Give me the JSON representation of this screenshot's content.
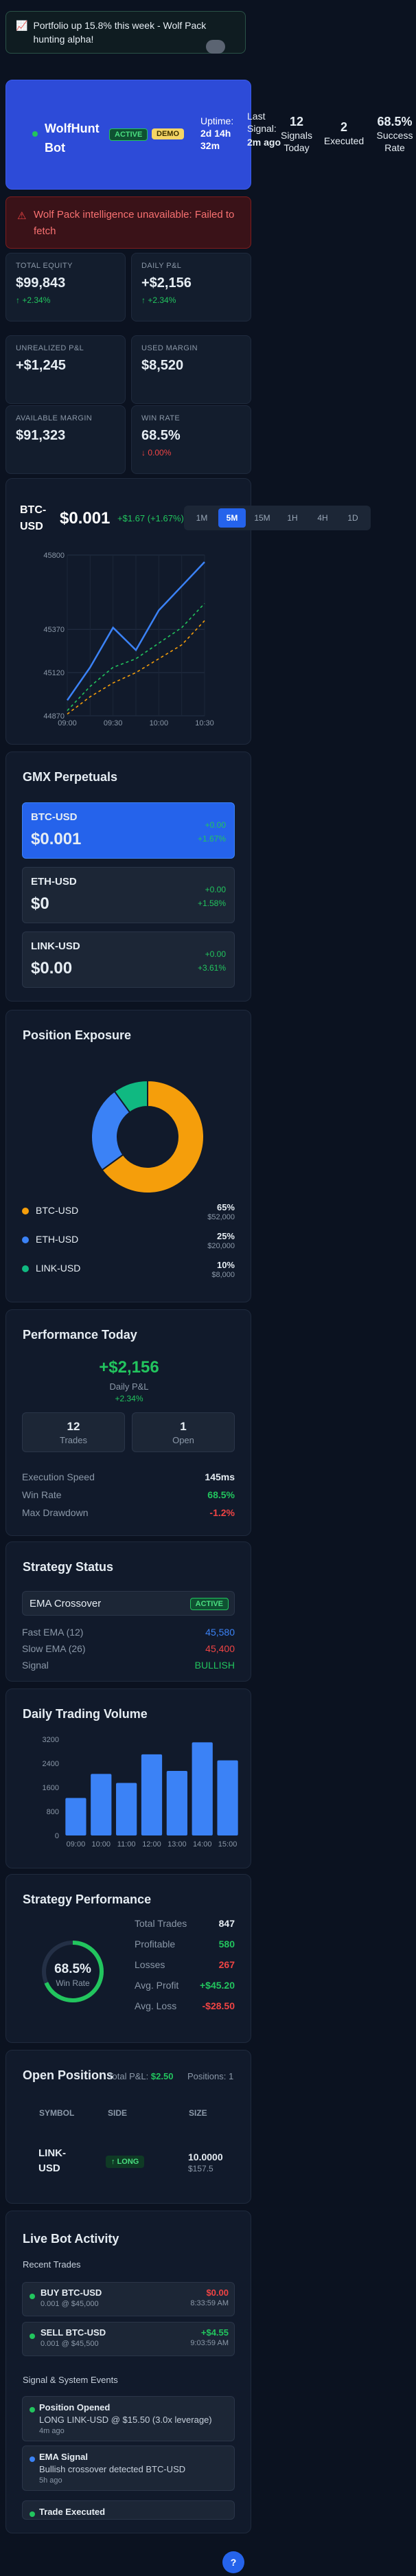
{
  "toast": {
    "text": "Portfolio up 15.8% this week - Wolf Pack hunting alpha!",
    "icon": "chart-up-icon"
  },
  "hero": {
    "bot_name": "WolfHunt Bot",
    "badge_active": "ACTIVE",
    "badge_demo": "DEMO",
    "uptime_label": "Uptime:",
    "uptime_value": "2d 14h 32m",
    "last_signal_label": "Last Signal:",
    "last_signal_value": "2m ago",
    "signals_today_value": "12",
    "signals_today_label": "Signals Today",
    "executed_value": "2",
    "executed_label": "Executed",
    "success_value": "68.5%",
    "success_label": "Success Rate"
  },
  "alert": {
    "text": "Wolf Pack intelligence unavailable: Failed to fetch",
    "icon": "warning-icon"
  },
  "metrics": [
    {
      "label": "TOTAL EQUITY",
      "value": "$99,843",
      "sub": "+2.34%",
      "sub_color": "#22c55e",
      "arrow": "↑"
    },
    {
      "label": "DAILY P&L",
      "value": "+$2,156",
      "sub": "+2.34%",
      "sub_color": "#22c55e",
      "arrow": "↑"
    },
    {
      "label": "UNREALIZED P&L",
      "value": "+$1,245",
      "sub": "",
      "sub_color": "#22c55e",
      "arrow": ""
    },
    {
      "label": "USED MARGIN",
      "value": "$8,520",
      "sub": "",
      "sub_color": "#22c55e",
      "arrow": ""
    },
    {
      "label": "AVAILABLE MARGIN",
      "value": "$91,323",
      "sub": "",
      "sub_color": "#22c55e",
      "arrow": ""
    },
    {
      "label": "WIN RATE",
      "value": "68.5%",
      "sub": "0.00%",
      "sub_color": "#ef4444",
      "arrow": "↓"
    }
  ],
  "price_chart": {
    "symbol": "BTC-USD",
    "price": "$0.001",
    "change": "+$1.67 (+1.67%)",
    "timeframes": [
      "1M",
      "5M",
      "15M",
      "1H",
      "4H",
      "1D"
    ],
    "active_timeframe": "5M"
  },
  "chart_data": {
    "type": "line",
    "x": [
      "09:00",
      "09:15",
      "09:30",
      "09:45",
      "10:00",
      "10:15",
      "10:30"
    ],
    "x_ticks": [
      "09:00",
      "09:30",
      "10:00",
      "10:30"
    ],
    "y_ticks": [
      "44870",
      "45120",
      "45370",
      "45800"
    ],
    "ylim": [
      44870,
      45800
    ],
    "series": [
      {
        "color": "#3b82f6",
        "style": "solid",
        "values": [
          44960,
          45150,
          45380,
          45250,
          45480,
          45620,
          45760
        ]
      },
      {
        "color": "#22c55e",
        "style": "dashed",
        "values": [
          44900,
          45040,
          45150,
          45200,
          45290,
          45380,
          45520
        ]
      },
      {
        "color": "#f59e0b",
        "style": "dashed",
        "values": [
          44880,
          44980,
          45060,
          45120,
          45200,
          45280,
          45420
        ]
      }
    ],
    "grid": true
  },
  "perpetuals": {
    "title": "GMX Perpetuals",
    "items": [
      {
        "symbol": "BTC-USD",
        "price": "$0.001",
        "change_abs": "+0.00",
        "change_pct": "+1.67%",
        "active": true
      },
      {
        "symbol": "ETH-USD",
        "price": "$0",
        "change_abs": "+0.00",
        "change_pct": "+1.58%",
        "active": false
      },
      {
        "symbol": "LINK-USD",
        "price": "$0.00",
        "change_abs": "+0.00",
        "change_pct": "+3.61%",
        "active": false
      }
    ]
  },
  "exposure": {
    "title": "Position Exposure",
    "slices": [
      {
        "name": "BTC-USD",
        "pct": "65%",
        "value": "$52,000",
        "fraction": 0.65,
        "color": "#f59e0b"
      },
      {
        "name": "ETH-USD",
        "pct": "25%",
        "value": "$20,000",
        "fraction": 0.25,
        "color": "#3b82f6"
      },
      {
        "name": "LINK-USD",
        "pct": "10%",
        "value": "$8,000",
        "fraction": 0.1,
        "color": "#10b981"
      }
    ]
  },
  "performance_today": {
    "title": "Performance Today",
    "pnl": "+$2,156",
    "pnl_label": "Daily P&L",
    "pnl_pct": "+2.34%",
    "trades_value": "12",
    "trades_label": "Trades",
    "open_value": "1",
    "open_label": "Open",
    "rows": [
      {
        "label": "Execution Speed",
        "value": "145ms",
        "color": "#e6edf3"
      },
      {
        "label": "Win Rate",
        "value": "68.5%",
        "color": "#22c55e"
      },
      {
        "label": "Max Drawdown",
        "value": "-1.2%",
        "color": "#ef4444"
      }
    ]
  },
  "strategy_status": {
    "title": "Strategy Status",
    "strategy": "EMA Crossover",
    "badge": "ACTIVE",
    "rows": [
      {
        "label": "Fast EMA (12)",
        "value": "45,580",
        "color": "#3b82f6"
      },
      {
        "label": "Slow EMA (26)",
        "value": "45,400",
        "color": "#ef4444"
      },
      {
        "label": "Signal",
        "value": "BULLISH",
        "color": "#22c55e"
      }
    ]
  },
  "volume": {
    "title": "Daily Trading Volume",
    "y_ticks": [
      "0",
      "800",
      "1600",
      "2400",
      "3200"
    ],
    "categories": [
      "09:00",
      "10:00",
      "11:00",
      "12:00",
      "13:00",
      "14:00",
      "15:00"
    ],
    "values": [
      1250,
      2050,
      1750,
      2700,
      2150,
      3100,
      2500
    ],
    "ymax": 3200
  },
  "strategy_perf": {
    "title": "Strategy Performance",
    "win_rate": "68.5%",
    "win_rate_label": "Win Rate",
    "win_fraction": 0.685,
    "rows": [
      {
        "label": "Total Trades",
        "value": "847",
        "color": "#e6edf3"
      },
      {
        "label": "Profitable",
        "value": "580",
        "color": "#22c55e"
      },
      {
        "label": "Losses",
        "value": "267",
        "color": "#ef4444"
      },
      {
        "label": "Avg. Profit",
        "value": "+$45.20",
        "color": "#22c55e"
      },
      {
        "label": "Avg. Loss",
        "value": "-$28.50",
        "color": "#ef4444"
      }
    ]
  },
  "positions": {
    "title": "Open Positions",
    "total_pnl_label": "Total P&L:",
    "total_pnl_value": "$2.50",
    "count_label": "Positions: 1",
    "columns": [
      "SYMBOL",
      "SIDE",
      "SIZE"
    ],
    "rows": [
      {
        "symbol": "LINK-USD",
        "side": "LONG",
        "size": "10.0000",
        "size_usd": "$157.5"
      }
    ]
  },
  "activity": {
    "title": "Live Bot Activity",
    "recent_label": "Recent Trades",
    "trades": [
      {
        "title": "BUY BTC-USD",
        "detail": "0.001 @ $45,000",
        "pnl": "$0.00",
        "pnl_color": "#ef4444",
        "time": "8:33:59 AM"
      },
      {
        "title": "SELL BTC-USD",
        "detail": "0.001 @ $45,500",
        "pnl": "+$4.55",
        "pnl_color": "#22c55e",
        "time": "9:03:59 AM"
      }
    ],
    "events_label": "Signal & System Events",
    "events": [
      {
        "title": "Position Opened",
        "detail": "LONG LINK-USD @ $15.50 (3.0x leverage)",
        "time": "4m ago",
        "color": "#22c55e"
      },
      {
        "title": "EMA Signal",
        "detail": "Bullish crossover detected BTC-USD",
        "time": "5h ago",
        "color": "#3b82f6"
      },
      {
        "title": "Trade Executed",
        "detail": "",
        "time": "",
        "color": "#22c55e"
      }
    ]
  },
  "help_icon": "?"
}
